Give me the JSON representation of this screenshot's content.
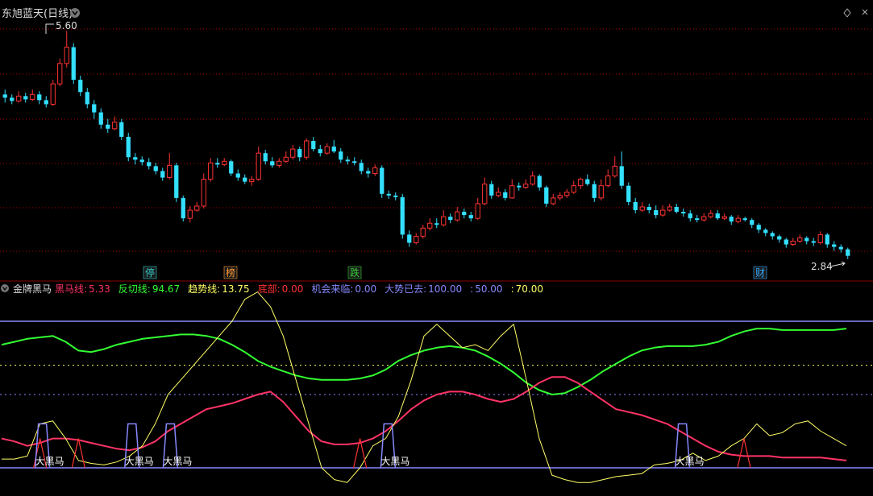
{
  "top_panel": {
    "title": "东旭蓝天(日线)",
    "high_label": "5.60",
    "low_label": "2.84",
    "event_tags": [
      {
        "label": "停",
        "color": "#33cccc"
      },
      {
        "label": "榜",
        "color": "#ff9933"
      },
      {
        "label": "跌",
        "color": "#33cc33"
      },
      {
        "label": "财",
        "color": "#33aaff"
      }
    ]
  },
  "indicator_panel": {
    "name": "金牌黑马",
    "legend": [
      {
        "label": "黑马线:",
        "value": "5.33",
        "color": "#ff3366"
      },
      {
        "label": "反切线:",
        "value": "94.67",
        "color": "#33ff33"
      },
      {
        "label": "趋势线:",
        "value": "13.75",
        "color": "#ffff66"
      },
      {
        "label": "底部:",
        "value": "0.00",
        "color": "#ff3333"
      },
      {
        "label": "机会来临:",
        "value": "0.00",
        "color": "#8888ff"
      },
      {
        "label": "大势已去:",
        "value": "100.00",
        "color": "#8888ff"
      },
      {
        "label": ":",
        "value": "50.00",
        "color": "#8888ff"
      },
      {
        "label": ":",
        "value": "70.00",
        "color": "#ffff66"
      }
    ],
    "signal_label": "大黑马"
  },
  "chart_data": [
    {
      "type": "candlestick",
      "title": "东旭蓝天(日线)",
      "ylim": [
        2.6,
        5.9
      ],
      "colors": {
        "up": "#ff3333",
        "down": "#33e0ff"
      },
      "candles": [
        [
          4.82,
          4.78,
          4.88,
          4.72
        ],
        [
          4.78,
          4.74,
          4.82,
          4.7
        ],
        [
          4.74,
          4.8,
          4.86,
          4.72
        ],
        [
          4.8,
          4.76,
          4.84,
          4.72
        ],
        [
          4.76,
          4.82,
          4.88,
          4.74
        ],
        [
          4.82,
          4.75,
          4.86,
          4.7
        ],
        [
          4.75,
          4.7,
          4.8,
          4.66
        ],
        [
          4.7,
          4.95,
          5.0,
          4.68
        ],
        [
          4.95,
          5.2,
          5.26,
          4.92
        ],
        [
          5.2,
          5.4,
          5.6,
          5.15
        ],
        [
          5.4,
          5.0,
          5.45,
          4.95
        ],
        [
          5.0,
          4.85,
          5.05,
          4.8
        ],
        [
          4.85,
          4.7,
          4.9,
          4.65
        ],
        [
          4.7,
          4.6,
          4.75,
          4.52
        ],
        [
          4.6,
          4.45,
          4.65,
          4.4
        ],
        [
          4.45,
          4.4,
          4.52,
          4.35
        ],
        [
          4.4,
          4.48,
          4.55,
          4.38
        ],
        [
          4.48,
          4.3,
          4.52,
          4.26
        ],
        [
          4.3,
          4.05,
          4.35,
          4.0
        ],
        [
          4.05,
          4.02,
          4.1,
          3.96
        ],
        [
          4.02,
          3.99,
          4.06,
          3.95
        ],
        [
          3.99,
          3.94,
          4.04,
          3.9
        ],
        [
          3.94,
          3.88,
          3.98,
          3.84
        ],
        [
          3.88,
          3.8,
          3.92,
          3.76
        ],
        [
          3.8,
          3.95,
          4.1,
          3.78
        ],
        [
          3.95,
          3.55,
          3.98,
          3.5
        ],
        [
          3.55,
          3.3,
          3.58,
          3.26
        ],
        [
          3.3,
          3.4,
          3.45,
          3.25
        ],
        [
          3.4,
          3.45,
          3.5,
          3.38
        ],
        [
          3.45,
          3.78,
          3.85,
          3.42
        ],
        [
          3.78,
          3.98,
          4.04,
          3.75
        ],
        [
          3.98,
          3.96,
          4.04,
          3.92
        ],
        [
          3.96,
          4.0,
          4.04,
          3.94
        ],
        [
          4.0,
          3.85,
          4.02,
          3.82
        ],
        [
          3.85,
          3.8,
          3.9,
          3.76
        ],
        [
          3.8,
          3.75,
          3.84,
          3.72
        ],
        [
          3.75,
          3.78,
          3.82,
          3.7
        ],
        [
          3.78,
          4.1,
          4.18,
          3.76
        ],
        [
          4.1,
          4.0,
          4.14,
          3.96
        ],
        [
          4.0,
          3.95,
          4.05,
          3.92
        ],
        [
          3.95,
          4.0,
          4.04,
          3.92
        ],
        [
          4.0,
          4.05,
          4.12,
          3.98
        ],
        [
          4.05,
          4.15,
          4.2,
          4.02
        ],
        [
          4.15,
          4.05,
          4.18,
          4.0
        ],
        [
          4.05,
          4.25,
          4.28,
          4.02
        ],
        [
          4.25,
          4.15,
          4.3,
          4.12
        ],
        [
          4.15,
          4.1,
          4.2,
          4.06
        ],
        [
          4.1,
          4.18,
          4.22,
          4.08
        ],
        [
          4.18,
          4.12,
          4.26,
          4.1
        ],
        [
          4.12,
          4.02,
          4.16,
          3.98
        ],
        [
          4.02,
          4.0,
          4.06,
          3.96
        ],
        [
          4.0,
          3.98,
          4.05,
          3.95
        ],
        [
          3.98,
          3.88,
          4.02,
          3.84
        ],
        [
          3.88,
          3.85,
          3.92,
          3.8
        ],
        [
          3.85,
          3.92,
          3.96,
          3.82
        ],
        [
          3.92,
          3.6,
          3.95,
          3.55
        ],
        [
          3.6,
          3.58,
          3.64,
          3.54
        ],
        [
          3.58,
          3.56,
          3.62,
          3.52
        ],
        [
          3.56,
          3.1,
          3.6,
          3.05
        ],
        [
          3.1,
          3.0,
          3.15,
          2.95
        ],
        [
          3.0,
          3.08,
          3.12,
          2.98
        ],
        [
          3.08,
          3.18,
          3.22,
          3.05
        ],
        [
          3.18,
          3.24,
          3.3,
          3.15
        ],
        [
          3.24,
          3.22,
          3.3,
          3.18
        ],
        [
          3.22,
          3.32,
          3.4,
          3.2
        ],
        [
          3.32,
          3.28,
          3.36,
          3.24
        ],
        [
          3.28,
          3.38,
          3.44,
          3.26
        ],
        [
          3.38,
          3.34,
          3.42,
          3.3
        ],
        [
          3.34,
          3.3,
          3.38,
          3.26
        ],
        [
          3.3,
          3.48,
          3.55,
          3.28
        ],
        [
          3.48,
          3.72,
          3.8,
          3.46
        ],
        [
          3.72,
          3.58,
          3.76,
          3.54
        ],
        [
          3.58,
          3.62,
          3.68,
          3.56
        ],
        [
          3.62,
          3.55,
          3.66,
          3.52
        ],
        [
          3.55,
          3.7,
          3.78,
          3.54
        ],
        [
          3.7,
          3.68,
          3.74,
          3.64
        ],
        [
          3.68,
          3.72,
          3.78,
          3.66
        ],
        [
          3.72,
          3.82,
          3.88,
          3.7
        ],
        [
          3.82,
          3.68,
          3.84,
          3.64
        ],
        [
          3.68,
          3.48,
          3.7,
          3.44
        ],
        [
          3.48,
          3.55,
          3.6,
          3.46
        ],
        [
          3.55,
          3.58,
          3.62,
          3.52
        ],
        [
          3.58,
          3.62,
          3.66,
          3.55
        ],
        [
          3.62,
          3.7,
          3.76,
          3.6
        ],
        [
          3.7,
          3.78,
          3.8,
          3.66
        ],
        [
          3.78,
          3.72,
          3.84,
          3.7
        ],
        [
          3.72,
          3.55,
          3.76,
          3.5
        ],
        [
          3.55,
          3.7,
          3.78,
          3.52
        ],
        [
          3.7,
          3.82,
          3.9,
          3.68
        ],
        [
          3.82,
          3.94,
          4.06,
          3.8
        ],
        [
          3.94,
          3.7,
          4.12,
          3.66
        ],
        [
          3.7,
          3.5,
          3.74,
          3.46
        ],
        [
          3.5,
          3.4,
          3.55,
          3.36
        ],
        [
          3.4,
          3.44,
          3.5,
          3.38
        ],
        [
          3.44,
          3.4,
          3.48,
          3.36
        ],
        [
          3.4,
          3.34,
          3.46,
          3.3
        ],
        [
          3.34,
          3.4,
          3.46,
          3.32
        ],
        [
          3.4,
          3.44,
          3.48,
          3.38
        ],
        [
          3.44,
          3.38,
          3.48,
          3.36
        ],
        [
          3.38,
          3.36,
          3.42,
          3.32
        ],
        [
          3.36,
          3.3,
          3.4,
          3.26
        ],
        [
          3.3,
          3.28,
          3.34,
          3.25
        ],
        [
          3.28,
          3.32,
          3.36,
          3.26
        ],
        [
          3.32,
          3.36,
          3.4,
          3.3
        ],
        [
          3.36,
          3.3,
          3.4,
          3.28
        ],
        [
          3.3,
          3.32,
          3.36,
          3.28
        ],
        [
          3.32,
          3.26,
          3.34,
          3.22
        ],
        [
          3.26,
          3.3,
          3.34,
          3.24
        ],
        [
          3.3,
          3.28,
          3.32,
          3.26
        ],
        [
          3.28,
          3.22,
          3.3,
          3.18
        ],
        [
          3.22,
          3.16,
          3.24,
          3.12
        ],
        [
          3.16,
          3.12,
          3.18,
          3.08
        ],
        [
          3.12,
          3.08,
          3.14,
          3.04
        ],
        [
          3.08,
          3.04,
          3.1,
          3.0
        ],
        [
          3.04,
          2.98,
          3.06,
          2.94
        ],
        [
          2.98,
          3.02,
          3.06,
          2.96
        ],
        [
          3.02,
          3.06,
          3.1,
          3.0
        ],
        [
          3.06,
          3.02,
          3.08,
          2.98
        ],
        [
          3.02,
          3.0,
          3.06,
          2.96
        ],
        [
          3.0,
          3.1,
          3.14,
          2.98
        ],
        [
          3.1,
          2.98,
          3.12,
          2.94
        ],
        [
          2.98,
          2.95,
          3.02,
          2.9
        ],
        [
          2.95,
          2.92,
          2.98,
          2.88
        ],
        [
          2.92,
          2.84,
          2.94,
          2.8
        ]
      ]
    },
    {
      "type": "line",
      "title": "金牌黑马",
      "ylim": [
        -10,
        110
      ],
      "reference_lines": [
        {
          "value": 100,
          "color": "#8888ff",
          "style": "solid"
        },
        {
          "value": 70,
          "color": "#ffff66",
          "style": "dotted"
        },
        {
          "value": 50,
          "color": "#8888ff",
          "style": "dotted"
        },
        {
          "value": 0,
          "color": "#8888ff",
          "style": "solid"
        }
      ],
      "series": [
        {
          "name": "反切线",
          "color": "#33ff33",
          "values": [
            84,
            86,
            88,
            89,
            90,
            86,
            80,
            79,
            81,
            84,
            86,
            88,
            89,
            90,
            91,
            91,
            90,
            88,
            84,
            79,
            73,
            69,
            66,
            63,
            61,
            60,
            60,
            60,
            61,
            63,
            67,
            73,
            77,
            80,
            82,
            83,
            82,
            80,
            76,
            71,
            65,
            58,
            53,
            50,
            51,
            55,
            60,
            66,
            71,
            76,
            80,
            82,
            83,
            83,
            83,
            84,
            86,
            90,
            93,
            95,
            95,
            94,
            94,
            94,
            94,
            94,
            95
          ]
        },
        {
          "name": "黑马线",
          "color": "#ff3366",
          "values": [
            20,
            18,
            15,
            17,
            20,
            20,
            19,
            17,
            15,
            13,
            12,
            14,
            18,
            25,
            30,
            35,
            40,
            42,
            44,
            47,
            50,
            52,
            45,
            35,
            25,
            18,
            16,
            16,
            17,
            20,
            25,
            32,
            40,
            46,
            50,
            52,
            52,
            50,
            47,
            45,
            47,
            52,
            58,
            62,
            62,
            58,
            52,
            46,
            40,
            38,
            36,
            33,
            30,
            25,
            20,
            15,
            11,
            9,
            8,
            8,
            8,
            7,
            7,
            7,
            7,
            6,
            5
          ]
        },
        {
          "name": "趋势线",
          "color": "#ffff66",
          "values": [
            6,
            6,
            8,
            30,
            32,
            20,
            5,
            3,
            2,
            4,
            8,
            15,
            30,
            50,
            60,
            70,
            80,
            90,
            100,
            115,
            120,
            110,
            90,
            60,
            30,
            0,
            -8,
            -10,
            0,
            15,
            20,
            35,
            60,
            90,
            98,
            90,
            82,
            84,
            80,
            90,
            98,
            60,
            20,
            -5,
            -8,
            -10,
            -10,
            -8,
            -6,
            -5,
            -4,
            2,
            3,
            5,
            10,
            5,
            8,
            15,
            20,
            30,
            22,
            24,
            30,
            32,
            25,
            20,
            15
          ]
        },
        {
          "name": "底部",
          "color": "#ff3333",
          "values": [
            0,
            0,
            0,
            20,
            0,
            0,
            20,
            0,
            0,
            0,
            0,
            0,
            0,
            0,
            0,
            0,
            0,
            0,
            0,
            0,
            0,
            0,
            0,
            0,
            0,
            0,
            0,
            0,
            20,
            0,
            0,
            0,
            0,
            0,
            0,
            0,
            0,
            0,
            0,
            0,
            0,
            0,
            0,
            0,
            0,
            0,
            0,
            0,
            0,
            0,
            0,
            0,
            0,
            0,
            0,
            0,
            0,
            0,
            20,
            0,
            0,
            0,
            0,
            0,
            0,
            0,
            0
          ]
        }
      ],
      "signals": [
        {
          "name": "大黑马",
          "x_index": 3
        },
        {
          "name": "大黑马",
          "x_index": 10
        },
        {
          "name": "大黑马",
          "x_index": 13
        },
        {
          "name": "大黑马",
          "x_index": 30
        },
        {
          "name": "大黑马",
          "x_index": 53
        }
      ]
    }
  ]
}
